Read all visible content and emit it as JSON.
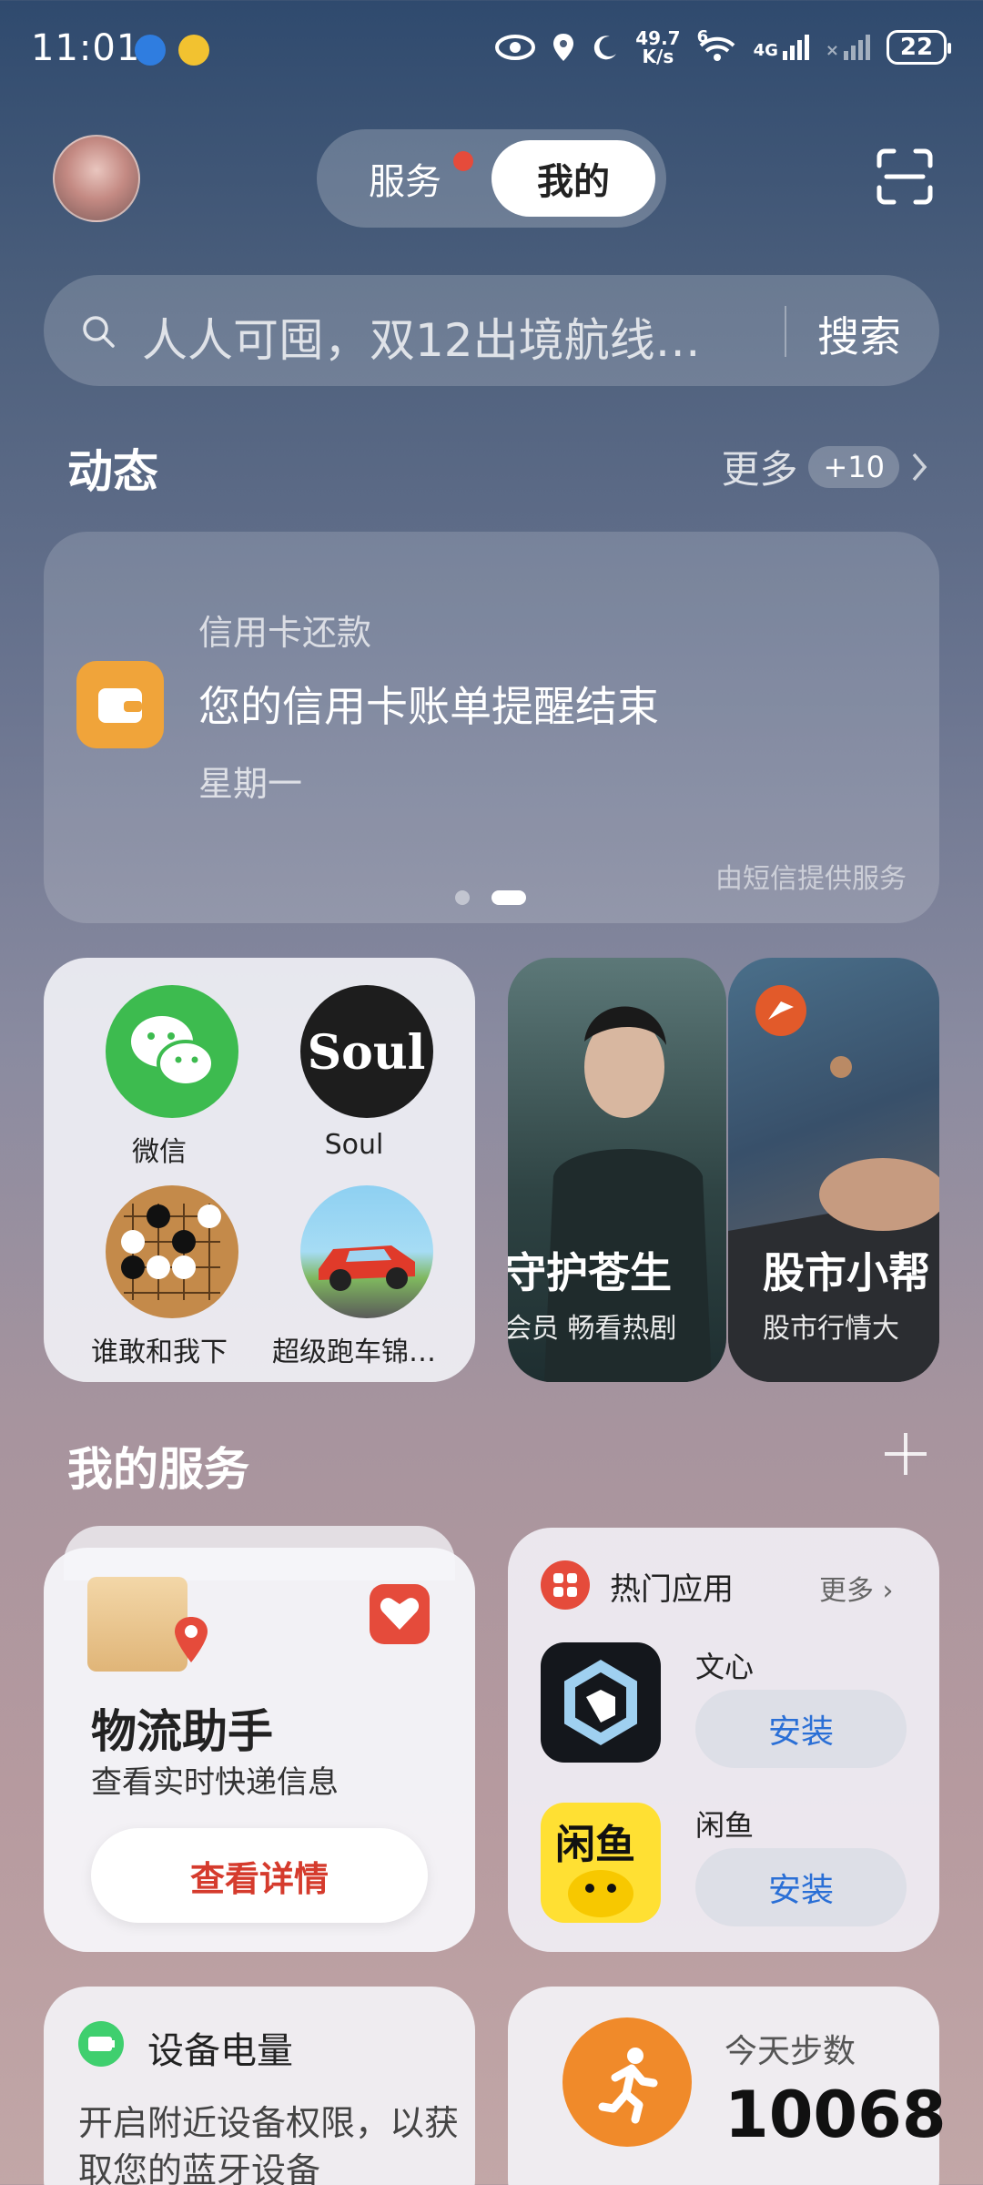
{
  "status_bar": {
    "time": "11:01",
    "net_speed_top": "49.7",
    "net_speed_bottom": "K/s",
    "wifi_badge": "6",
    "cell_label": "4G",
    "battery": "22"
  },
  "header": {
    "tabs": [
      {
        "label": "服务",
        "active": false,
        "has_dot": true
      },
      {
        "label": "我的",
        "active": true
      }
    ]
  },
  "search": {
    "placeholder": "人人可囤，双12出境航线…",
    "button": "搜索"
  },
  "dynamics": {
    "title": "动态",
    "more_label": "更多",
    "more_count": "+10",
    "card": {
      "category": "信用卡还款",
      "title": "您的信用卡账单提醒结束",
      "date": "星期一",
      "source": "由短信提供服务"
    }
  },
  "apps": [
    {
      "label": "微信",
      "icon": "wechat-icon"
    },
    {
      "label": "Soul",
      "icon": "soul-icon"
    },
    {
      "label": "谁敢和我下",
      "icon": "go-game-icon"
    },
    {
      "label": "超级跑车锦…",
      "icon": "race-car-icon"
    }
  ],
  "promos": [
    {
      "title": "守护苍生",
      "subtitle": "会员 畅看热剧"
    },
    {
      "title": "股市小帮",
      "subtitle": "股市行情大"
    }
  ],
  "my_services": {
    "title": "我的服务",
    "logistics": {
      "title": "物流助手",
      "subtitle": "查看实时快递信息",
      "button": "查看详情"
    },
    "hot_apps": {
      "title": "热门应用",
      "more": "更多",
      "apps": [
        {
          "name": "文心",
          "button": "安装",
          "icon": "wenxin-icon"
        },
        {
          "name": "闲鱼",
          "button": "安装",
          "icon": "xianyu-icon"
        }
      ]
    },
    "device_battery": {
      "title": "设备电量",
      "body": "开启附近设备权限，以获取您的蓝牙设备"
    },
    "steps": {
      "label": "今天步数",
      "value": "10068"
    }
  },
  "colors": {
    "accent_red": "#e54b3b",
    "install_blue": "#2a6fd6",
    "steps_orange": "#f08a2a",
    "wallet_orange": "#f0a43a"
  }
}
